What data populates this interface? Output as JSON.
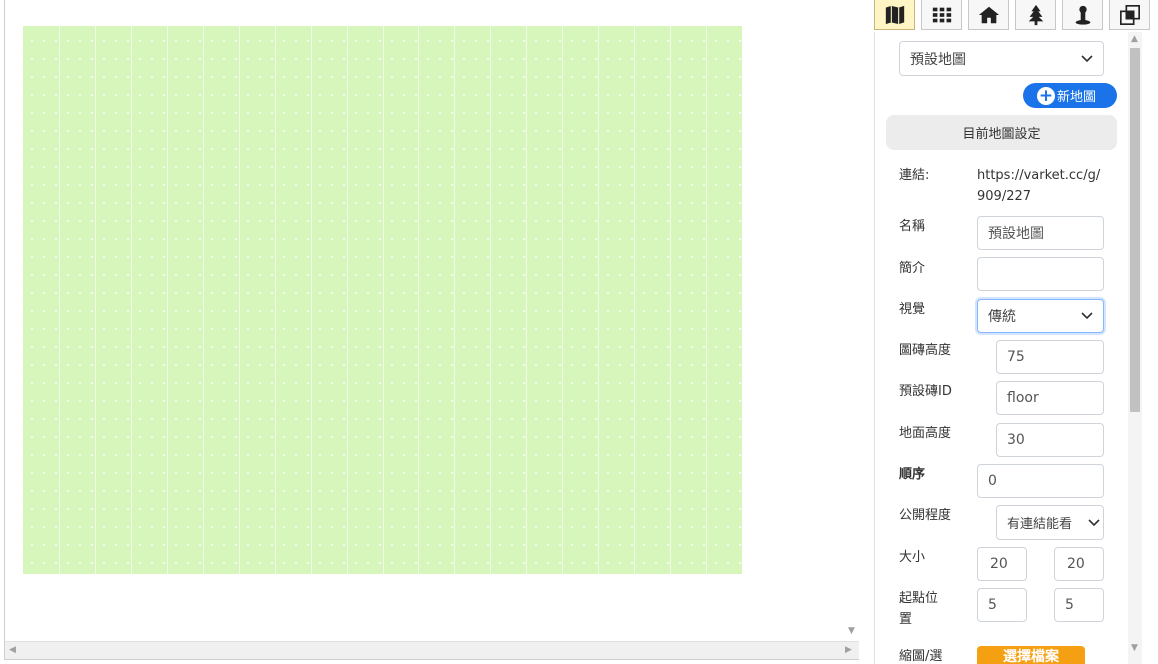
{
  "toolbar": {
    "tools": [
      {
        "icon": "map-icon",
        "active": true
      },
      {
        "icon": "grid-icon",
        "active": false
      },
      {
        "icon": "home-icon",
        "active": false
      },
      {
        "icon": "tree-icon",
        "active": false
      },
      {
        "icon": "figure-icon",
        "active": false
      },
      {
        "icon": "layers-icon",
        "active": false
      }
    ]
  },
  "map_selector": {
    "value": "預設地圖"
  },
  "new_map_button": "新地圖",
  "current_settings_button": "目前地圖設定",
  "fields": {
    "link": {
      "label": "連結:",
      "value": "https://varket.cc/g/909/227"
    },
    "name": {
      "label": "名稱",
      "value": "預設地圖"
    },
    "intro": {
      "label": "簡介",
      "value": ""
    },
    "visual": {
      "label": "視覺",
      "value": "傳統"
    },
    "tile_height": {
      "label": "圖磚高度",
      "value": "75"
    },
    "default_tile_id": {
      "label": "預設磚ID",
      "value": "floor"
    },
    "ground_height": {
      "label": "地面高度",
      "value": "30"
    },
    "order": {
      "label": "順序",
      "value": "0"
    },
    "visibility": {
      "label": "公開程度",
      "value": "有連結能看"
    },
    "size": {
      "label": "大小",
      "value_w": "20",
      "value_h": "20"
    },
    "start_pos": {
      "label": "起點位置",
      "value_x": "5",
      "value_y": "5"
    },
    "thumbnail": {
      "label": "縮圖/選",
      "button": "選擇檔案"
    }
  },
  "colors": {
    "map_fill": "#d6f6bc",
    "accent": "#1a73e8",
    "file_button": "#f5a012"
  }
}
